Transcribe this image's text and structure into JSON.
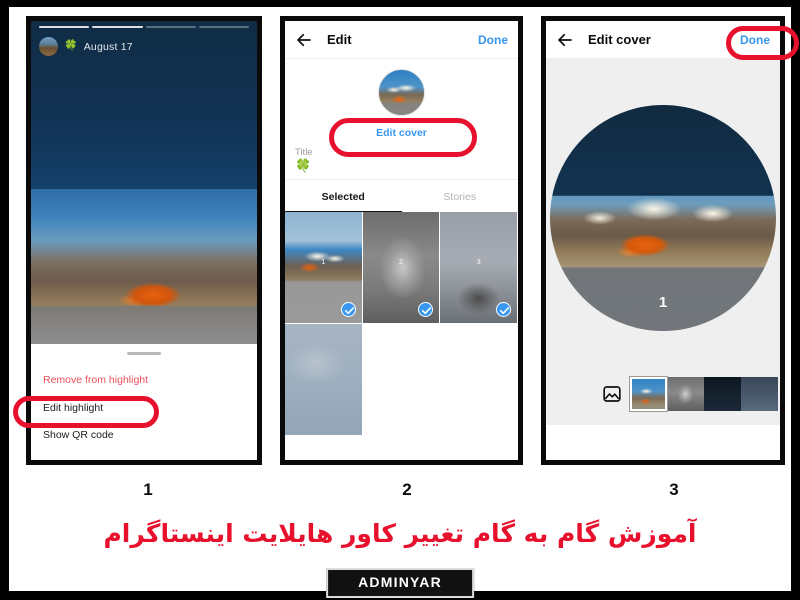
{
  "meta": {
    "caption": "آموزش گام به گام تغییر کاور هایلایت اینستاگرام",
    "brand": "ADMINYAR",
    "accent_red": "#e8112d",
    "link_blue": "#3897f0",
    "danger_red": "#e8505b"
  },
  "steps": [
    {
      "number": "1"
    },
    {
      "number": "2"
    },
    {
      "number": "3"
    }
  ],
  "panel1": {
    "story": {
      "date": "August 17",
      "clover": "🍀",
      "segments": 4
    },
    "sheet": {
      "items": [
        {
          "label": "Remove from highlight",
          "style": "danger"
        },
        {
          "label": "Edit highlight",
          "style": "normal",
          "highlighted": true
        },
        {
          "label": "Show QR code",
          "style": "normal"
        }
      ]
    }
  },
  "panel2": {
    "appbar": {
      "back_icon": "arrow-left-icon",
      "title": "Edit",
      "action": "Done"
    },
    "cover": {
      "edit_cover_label": "Edit cover"
    },
    "title_field": {
      "label": "Title",
      "value": "🍀"
    },
    "tabs": [
      {
        "label": "Selected",
        "active": true
      },
      {
        "label": "Stories",
        "active": false
      }
    ],
    "grid": [
      {
        "num": "1",
        "checked": true
      },
      {
        "num": "2",
        "checked": true
      },
      {
        "num": "3",
        "checked": true
      },
      {
        "num": "",
        "checked": false
      }
    ]
  },
  "panel3": {
    "appbar": {
      "back_icon": "arrow-left-icon",
      "title": "Edit cover",
      "action": "Done"
    },
    "crop": {
      "number": "1"
    },
    "filmstrip": {
      "gallery_icon": "image-gallery-icon",
      "selected_index": 0,
      "count": 4
    }
  }
}
